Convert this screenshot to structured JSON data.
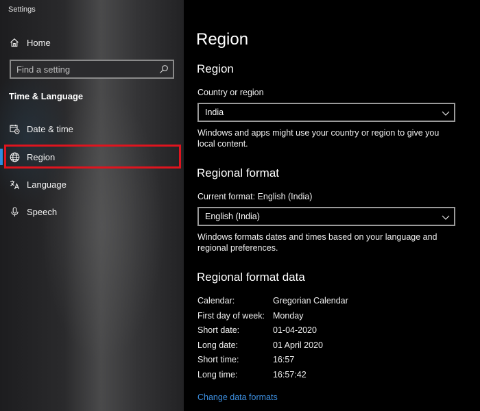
{
  "window": {
    "title": "Settings"
  },
  "sidebar": {
    "home_label": "Home",
    "search_placeholder": "Find a setting",
    "section_title": "Time & Language",
    "items": [
      {
        "label": "Date & time",
        "icon": "calendar-clock-icon"
      },
      {
        "label": "Region",
        "icon": "globe-icon",
        "selected": true
      },
      {
        "label": "Language",
        "icon": "language-icon"
      },
      {
        "label": "Speech",
        "icon": "microphone-icon"
      }
    ],
    "highlight_color": "#e0141e",
    "accent_color": "#2f8ddf"
  },
  "main": {
    "page_title": "Region",
    "region": {
      "heading": "Region",
      "country_label": "Country or region",
      "country_value": "India",
      "description": "Windows and apps might use your country or region to give you local content."
    },
    "regional_format": {
      "heading": "Regional format",
      "current_label": "Current format: English (India)",
      "format_value": "English (India)",
      "description": "Windows formats dates and times based on your language and regional preferences."
    },
    "format_data": {
      "heading": "Regional format data",
      "rows": [
        {
          "key": "Calendar:",
          "value": "Gregorian Calendar"
        },
        {
          "key": "First day of week:",
          "value": "Monday"
        },
        {
          "key": "Short date:",
          "value": "01-04-2020"
        },
        {
          "key": "Long date:",
          "value": "01 April 2020"
        },
        {
          "key": "Short time:",
          "value": "16:57"
        },
        {
          "key": "Long time:",
          "value": "16:57:42"
        }
      ],
      "link_label": "Change data formats",
      "link_color": "#3d8fe0"
    }
  }
}
